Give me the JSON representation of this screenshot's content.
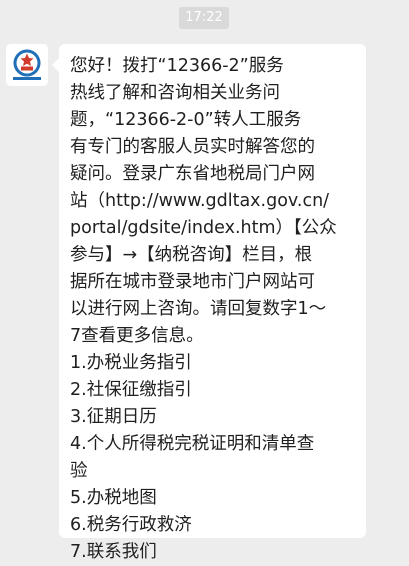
{
  "timestamp": "17:22",
  "sender": {
    "avatar_icon": "tax-bureau-emblem-icon",
    "avatar_color": "#1f6fb8",
    "avatar_accent": "#d23a2c"
  },
  "message": {
    "intro": "您好！拨打“12366-2”服务\n热线了解和咨询相关业务问\n题，“12366-2-0”转人工服务\n有专门的客服人员实时解答您的\n疑问。登录广东省地税局门户网\n站（http://www.gdltax.gov.cn/\nportal/gdsite/index.htm）【公众\n参与】→【纳税咨询】栏目，根\n据所在城市登录地市门户网站可\n以进行网上咨询。请回复数字1～\n7查看更多信息。",
    "menu": [
      {
        "label": "1.办税业务指引"
      },
      {
        "label": "2.社保征缴指引"
      },
      {
        "label": "3.征期日历"
      },
      {
        "label": "4.个人所得税完税证明和清单查\n验"
      },
      {
        "label": "5.办税地图"
      },
      {
        "label": "6.税务行政救济"
      },
      {
        "label": "7.联系我们"
      }
    ]
  }
}
